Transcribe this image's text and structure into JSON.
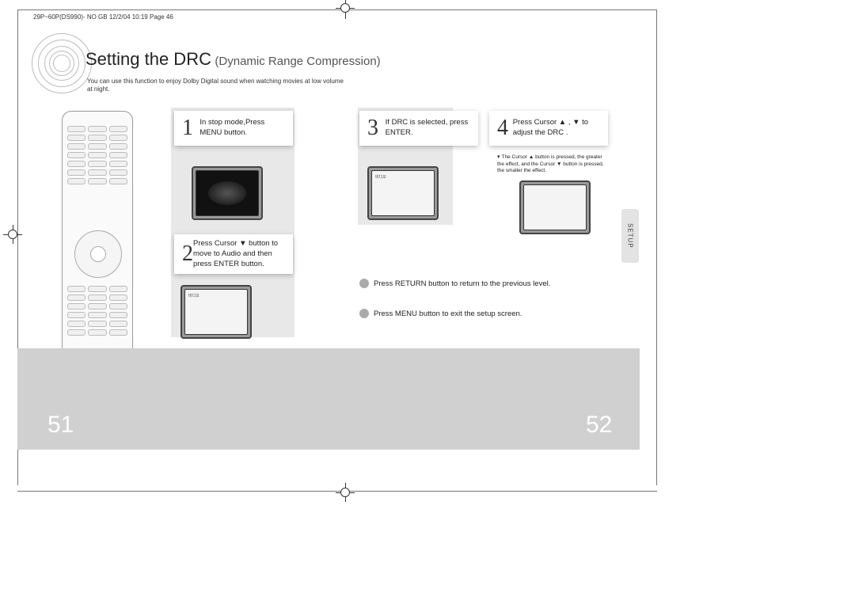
{
  "header_line": "29P~60P(DS990)- NO GB  12/2/04 10:19  Page 46",
  "title_main": "Setting the DRC",
  "title_sub": "(Dynamic Range Compression)",
  "title_desc": "You can use this function to enjoy Dolby Digital sound when watching movies at low volume at night.",
  "steps": {
    "s1": {
      "num": "1",
      "text": "In stop mode,Press MENU button."
    },
    "s2": {
      "num": "2",
      "text": "Press Cursor ▼ button to move to  Audio  and then press ENTER button."
    },
    "s3": {
      "num": "3",
      "text": "If  DRC  is selected, press ENTER."
    },
    "s4": {
      "num": "4",
      "text": "Press Cursor ▲ , ▼ to adjust the  DRC ."
    }
  },
  "note4": "The  Cursor ▲ button is pressed, the greater the effect, and the Cursor ▼ button is pressed, the smaller the effect.",
  "circ1": "Press RETURN button to return to the previous level.",
  "circ2": "Press MENU button to exit the setup screen.",
  "side_tab": "SETUP",
  "tv_tiny1": "비디오",
  "tv_tiny2": "비디오",
  "page_left": "51",
  "page_right": "52"
}
